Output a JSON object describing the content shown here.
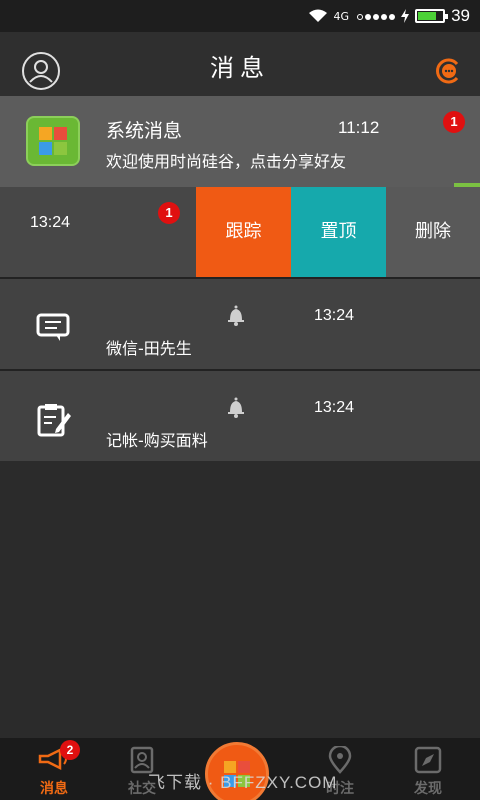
{
  "status_bar": {
    "network": "4G",
    "battery_level": 0.7,
    "time": "39"
  },
  "header": {
    "title": "消息",
    "accent_color": "#f06a14"
  },
  "messages": {
    "system": {
      "name": "系统消息",
      "time": "11:12",
      "preview": "欢迎使用时尚硅谷，点击分享好友",
      "unread": "1"
    },
    "swiped": {
      "time": "13:24",
      "unread": "1",
      "actions": {
        "track": "跟踪",
        "pin": "置顶",
        "delete": "删除"
      }
    },
    "items": [
      {
        "name": "微信-田先生",
        "time": "13:24",
        "icon": "chat-icon"
      },
      {
        "name": "记帐-购买面料",
        "time": "13:24",
        "icon": "note-edit-icon"
      }
    ]
  },
  "tabbar": {
    "tabs": [
      {
        "label": "消息",
        "icon": "megaphone-icon",
        "badge": "2",
        "active": true
      },
      {
        "label": "社交",
        "icon": "contacts-icon",
        "active": false
      },
      {
        "label": "时注",
        "icon": "location-icon",
        "active": false
      },
      {
        "label": "发现",
        "icon": "compass-icon",
        "active": false
      }
    ]
  },
  "watermark": "飞下载 · BFFZXY.COM",
  "colors": {
    "track": "#f05a14",
    "pin": "#16a9ac",
    "delete": "#595959",
    "badge": "#e01010"
  }
}
